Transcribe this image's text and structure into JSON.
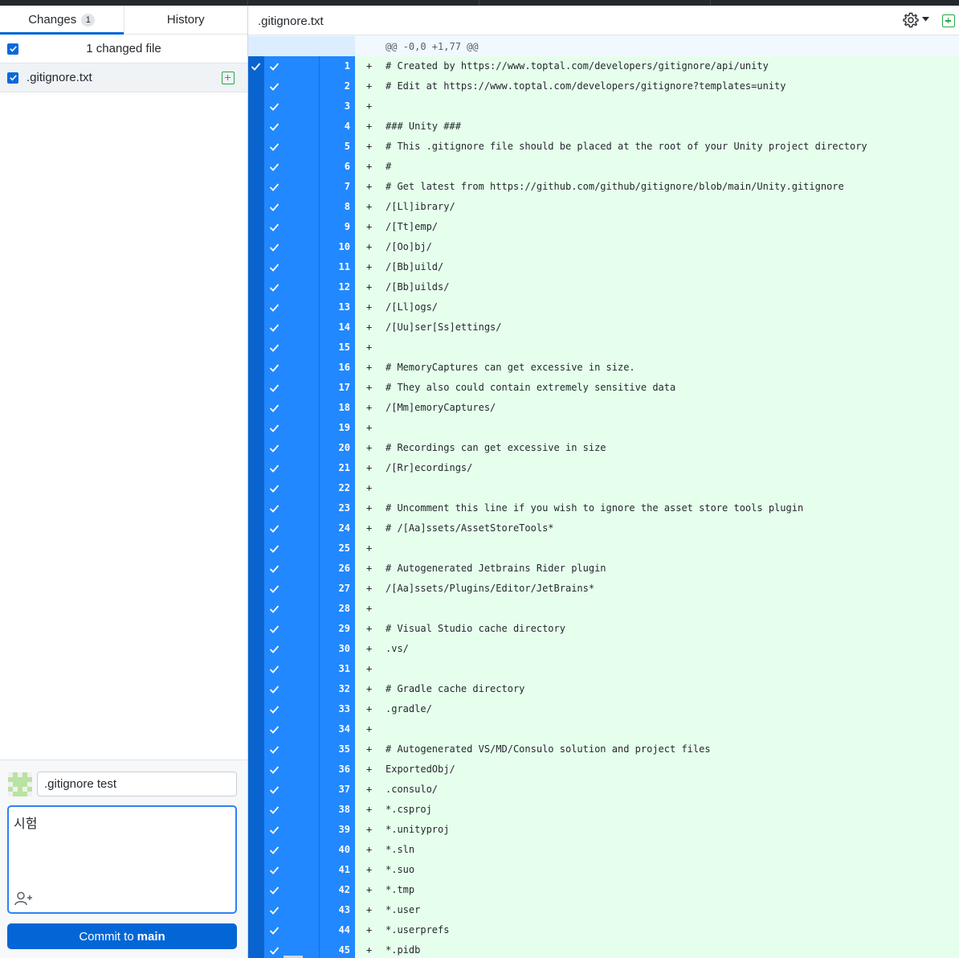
{
  "sidebar": {
    "tabs": [
      {
        "label": "Changes",
        "count": "1"
      },
      {
        "label": "History"
      }
    ],
    "changed_files_label": "1 changed file",
    "files": [
      {
        "name": ".gitignore.txt",
        "status": "added"
      }
    ],
    "commit": {
      "summary": ".gitignore test",
      "description": "시험",
      "button_prefix": "Commit to",
      "branch": "main"
    }
  },
  "diff": {
    "filename": ".gitignore.txt",
    "hunk_header": "@@ -0,0 +1,77 @@",
    "lines": [
      {
        "n": "1",
        "code": "# Created by https://www.toptal.com/developers/gitignore/api/unity"
      },
      {
        "n": "2",
        "code": "# Edit at https://www.toptal.com/developers/gitignore?templates=unity"
      },
      {
        "n": "3",
        "code": ""
      },
      {
        "n": "4",
        "code": "### Unity ###"
      },
      {
        "n": "5",
        "code": "# This .gitignore file should be placed at the root of your Unity project directory"
      },
      {
        "n": "6",
        "code": "#"
      },
      {
        "n": "7",
        "code": "# Get latest from https://github.com/github/gitignore/blob/main/Unity.gitignore"
      },
      {
        "n": "8",
        "code": "/[Ll]ibrary/"
      },
      {
        "n": "9",
        "code": "/[Tt]emp/"
      },
      {
        "n": "10",
        "code": "/[Oo]bj/"
      },
      {
        "n": "11",
        "code": "/[Bb]uild/"
      },
      {
        "n": "12",
        "code": "/[Bb]uilds/"
      },
      {
        "n": "13",
        "code": "/[Ll]ogs/"
      },
      {
        "n": "14",
        "code": "/[Uu]ser[Ss]ettings/"
      },
      {
        "n": "15",
        "code": ""
      },
      {
        "n": "16",
        "code": "# MemoryCaptures can get excessive in size."
      },
      {
        "n": "17",
        "code": "# They also could contain extremely sensitive data"
      },
      {
        "n": "18",
        "code": "/[Mm]emoryCaptures/"
      },
      {
        "n": "19",
        "code": ""
      },
      {
        "n": "20",
        "code": "# Recordings can get excessive in size"
      },
      {
        "n": "21",
        "code": "/[Rr]ecordings/"
      },
      {
        "n": "22",
        "code": ""
      },
      {
        "n": "23",
        "code": "# Uncomment this line if you wish to ignore the asset store tools plugin"
      },
      {
        "n": "24",
        "code": "# /[Aa]ssets/AssetStoreTools*"
      },
      {
        "n": "25",
        "code": ""
      },
      {
        "n": "26",
        "code": "# Autogenerated Jetbrains Rider plugin"
      },
      {
        "n": "27",
        "code": "/[Aa]ssets/Plugins/Editor/JetBrains*"
      },
      {
        "n": "28",
        "code": ""
      },
      {
        "n": "29",
        "code": "# Visual Studio cache directory"
      },
      {
        "n": "30",
        "code": ".vs/"
      },
      {
        "n": "31",
        "code": ""
      },
      {
        "n": "32",
        "code": "# Gradle cache directory"
      },
      {
        "n": "33",
        "code": ".gradle/"
      },
      {
        "n": "34",
        "code": ""
      },
      {
        "n": "35",
        "code": "# Autogenerated VS/MD/Consulo solution and project files"
      },
      {
        "n": "36",
        "code": "ExportedObj/"
      },
      {
        "n": "37",
        "code": ".consulo/"
      },
      {
        "n": "38",
        "code": "*.csproj"
      },
      {
        "n": "39",
        "code": "*.unityproj"
      },
      {
        "n": "40",
        "code": "*.sln"
      },
      {
        "n": "41",
        "code": "*.suo"
      },
      {
        "n": "42",
        "code": "*.tmp"
      },
      {
        "n": "43",
        "code": "*.user"
      },
      {
        "n": "44",
        "code": "*.userprefs"
      },
      {
        "n": "45",
        "code": "*.pidb"
      }
    ]
  },
  "icons": {
    "gear": "gear-icon",
    "add_file": "plus-square-icon",
    "check": "check-icon",
    "coauthor": "person-add-icon",
    "avatar": "identicon-avatar"
  },
  "colors": {
    "accent": "#0366d6",
    "selection_blue": "#2188ff",
    "added_bg": "#e6ffec",
    "added_icon": "#28a745"
  }
}
